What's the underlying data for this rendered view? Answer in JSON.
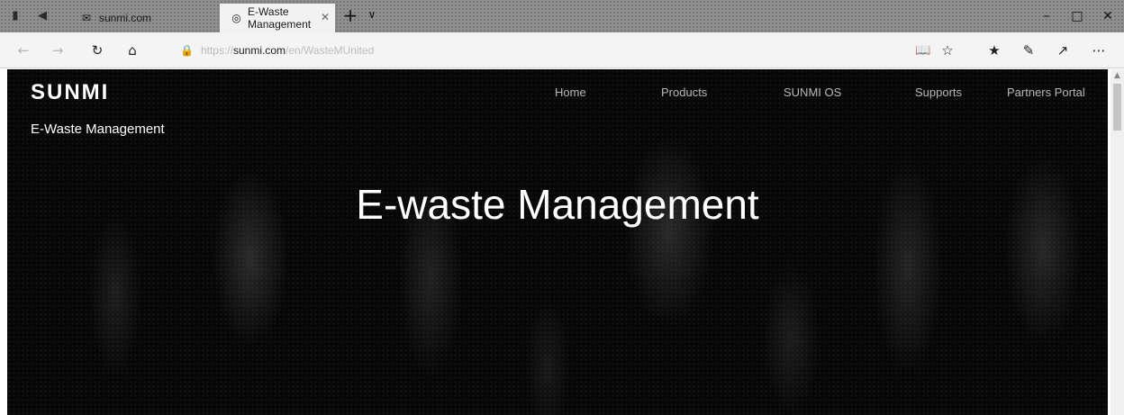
{
  "browser": {
    "tabs": [
      {
        "label": "sunmi.com",
        "active": false
      },
      {
        "label": "E-Waste Management",
        "active": true
      }
    ],
    "tab_close_glyph": "✕",
    "new_tab_glyph": "+",
    "url": {
      "protocol": "https://",
      "domain": "sunmi.com",
      "path": "/en/WasteMUnited"
    }
  },
  "site": {
    "logo_text": "SUNMI",
    "nav": [
      "Home",
      "Products",
      "SUNMI OS",
      "Supports",
      "Partners Portal"
    ],
    "breadcrumb": "E-Waste Management",
    "hero_title": "E-waste Management"
  },
  "colors": {
    "hero_background": "#070707",
    "hero_title": "#ffffff",
    "nav_text": "#b8b8b8",
    "tabstrip": "#8f8f8f"
  }
}
